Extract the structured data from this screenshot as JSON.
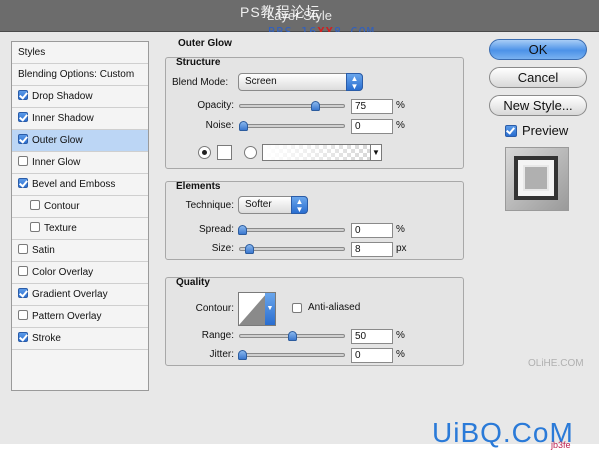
{
  "window": {
    "title": "Layer Style"
  },
  "watermarks": {
    "top": "PS教程论坛",
    "top_url_a": "BBS.16",
    "top_url_b": "XX",
    "top_url_c": "8.COM",
    "olihe": "OLiHE.COM",
    "uibq": "UiBQ.CoM",
    "uibq_sub": "jb3fe"
  },
  "styles_list": {
    "header": "Styles",
    "blending": "Blending Options: Custom",
    "items": [
      {
        "label": "Drop Shadow",
        "checked": true
      },
      {
        "label": "Inner Shadow",
        "checked": true
      },
      {
        "label": "Outer Glow",
        "checked": true,
        "selected": true
      },
      {
        "label": "Inner Glow",
        "checked": false
      },
      {
        "label": "Bevel and Emboss",
        "checked": true
      },
      {
        "label": "Contour",
        "checked": false,
        "indent": true
      },
      {
        "label": "Texture",
        "checked": false,
        "indent": true
      },
      {
        "label": "Satin",
        "checked": false
      },
      {
        "label": "Color Overlay",
        "checked": false
      },
      {
        "label": "Gradient Overlay",
        "checked": true
      },
      {
        "label": "Pattern Overlay",
        "checked": false
      },
      {
        "label": "Stroke",
        "checked": true
      }
    ]
  },
  "panel": {
    "title": "Outer Glow",
    "structure": {
      "title": "Structure",
      "blend_mode_label": "Blend Mode:",
      "blend_mode": "Screen",
      "opacity_label": "Opacity:",
      "opacity": "75",
      "opacity_unit": "%",
      "opacity_fraction": 0.75,
      "noise_label": "Noise:",
      "noise": "0",
      "noise_unit": "%",
      "noise_fraction": 0.0
    },
    "elements": {
      "title": "Elements",
      "technique_label": "Technique:",
      "technique": "Softer",
      "spread_label": "Spread:",
      "spread": "0",
      "spread_unit": "%",
      "size_label": "Size:",
      "size": "8",
      "size_unit": "px"
    },
    "quality": {
      "title": "Quality",
      "contour_label": "Contour:",
      "anti_aliased_label": "Anti-aliased",
      "anti_aliased": false,
      "range_label": "Range:",
      "range": "50",
      "range_unit": "%",
      "jitter_label": "Jitter:",
      "jitter": "0",
      "jitter_unit": "%"
    }
  },
  "buttons": {
    "ok": "OK",
    "cancel": "Cancel",
    "new_style": "New Style...",
    "preview": "Preview",
    "preview_checked": true
  },
  "colors": {
    "accent": "#2a6ed0",
    "selection": "#bcd6f5"
  }
}
